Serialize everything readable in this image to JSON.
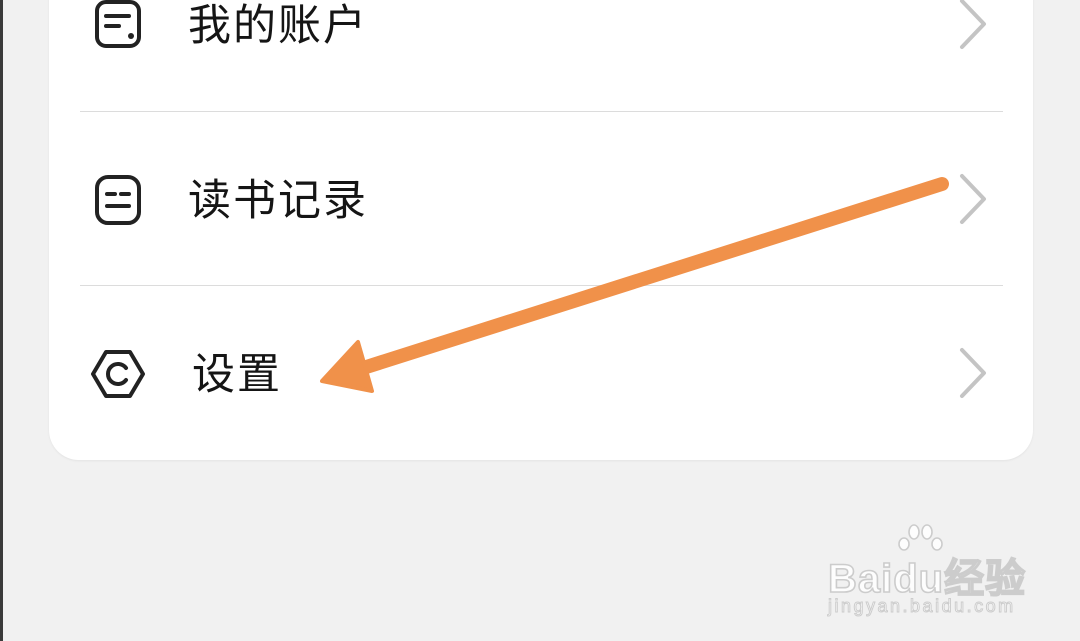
{
  "menu": {
    "items": [
      {
        "label": "我的账户",
        "icon": "account-card-icon"
      },
      {
        "label": "读书记录",
        "icon": "reading-record-icon"
      },
      {
        "label": "设置",
        "icon": "settings-hexagon-icon"
      }
    ],
    "chevron_icon": "chevron-right-icon"
  },
  "annotation": {
    "arrow_color": "#f0914a",
    "points_to": "设置"
  },
  "watermark": {
    "brand": "Baidu经验",
    "url": "jingyan.baidu.com"
  },
  "colors": {
    "background": "#f1f1f1",
    "card": "#ffffff",
    "text": "#151515",
    "chevron": "#c4c4c4",
    "divider": "#dcdcdc"
  }
}
